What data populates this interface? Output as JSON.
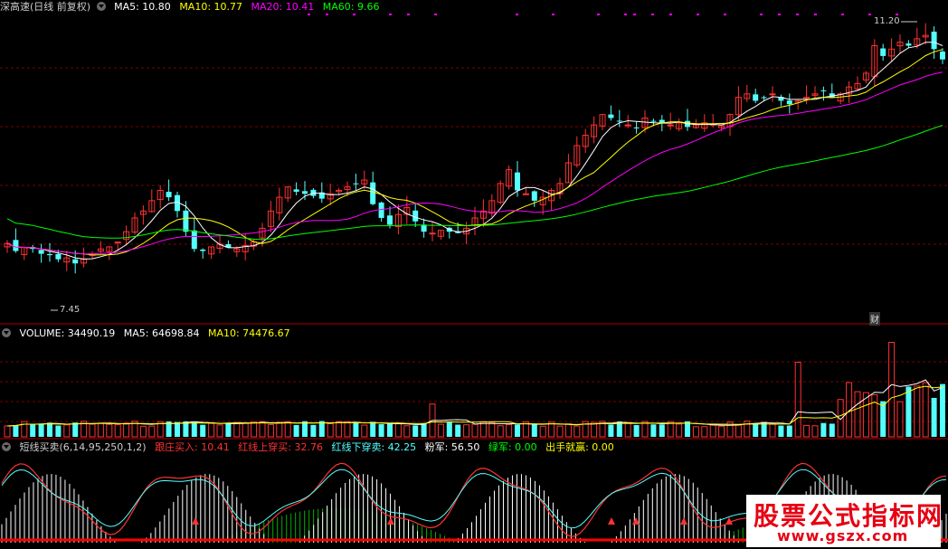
{
  "price_panel": {
    "title": "深高速",
    "mode": "(日线 前复权)",
    "ma5": "MA5: 10.80",
    "ma10": "MA10: 10.77",
    "ma20": "MA20: 10.41",
    "ma60": "MA60: 9.66",
    "high_label": "11.20",
    "low_label": "7.45",
    "event_tag": "财",
    "colors": {
      "ma5": "#ffffff",
      "ma10": "#ffff00",
      "ma20": "#ff00ff",
      "ma60": "#00ff00",
      "up": "#ff3232",
      "down": "#54ffff"
    }
  },
  "volume_panel": {
    "volume": "VOLUME: 34490.19",
    "ma5": "MA5: 64698.84",
    "ma10": "MA10: 74476.67"
  },
  "indicator_panel": {
    "name": "短线买卖(6,14,95,250,1,2)",
    "item1": "跟庄买入: 10.41",
    "item2": "红线上穿买: 32.76",
    "item3": "红线下穿卖: 42.25",
    "item4": "粉军: 56.50",
    "item5": "绿军: 0.00",
    "item6": "出手就赢: 0.00"
  },
  "watermark": {
    "title": "股票公式指标网",
    "url": "www.gszx.com"
  },
  "chart_data": {
    "type": "candlestick",
    "ylim": [
      7.2,
      11.4
    ],
    "closes": [
      8.13,
      8.02,
      8.07,
      8.05,
      7.98,
      7.96,
      7.9,
      7.92,
      7.84,
      7.9,
      7.98,
      8.05,
      8.08,
      8.15,
      8.3,
      8.5,
      8.6,
      8.75,
      8.9,
      8.8,
      8.6,
      8.3,
      8.05,
      8.02,
      8.08,
      8.12,
      8.07,
      8.05,
      8.1,
      8.15,
      8.35,
      8.6,
      8.8,
      8.95,
      8.88,
      8.85,
      8.82,
      8.78,
      8.85,
      8.9,
      8.95,
      9.0,
      9.05,
      8.7,
      8.5,
      8.4,
      8.55,
      8.65,
      8.45,
      8.3,
      8.28,
      8.32,
      8.3,
      8.28,
      8.35,
      8.5,
      8.6,
      8.75,
      9.0,
      9.2,
      8.9,
      8.85,
      8.75,
      8.8,
      8.9,
      9.0,
      9.3,
      9.55,
      9.7,
      9.85,
      10.0,
      9.95,
      9.9,
      9.85,
      9.8,
      9.95,
      9.9,
      9.88,
      9.85,
      9.88,
      9.82,
      9.85,
      9.88,
      9.86,
      9.84,
      10.0,
      10.25,
      10.3,
      10.2,
      10.25,
      10.3,
      10.2,
      10.15,
      10.2,
      10.25,
      10.3,
      10.35,
      10.25,
      10.3,
      10.4,
      10.45,
      10.6,
      11.0,
      10.85,
      10.95,
      11.05,
      11.0,
      11.1,
      11.15,
      10.95,
      10.8
    ]
  }
}
